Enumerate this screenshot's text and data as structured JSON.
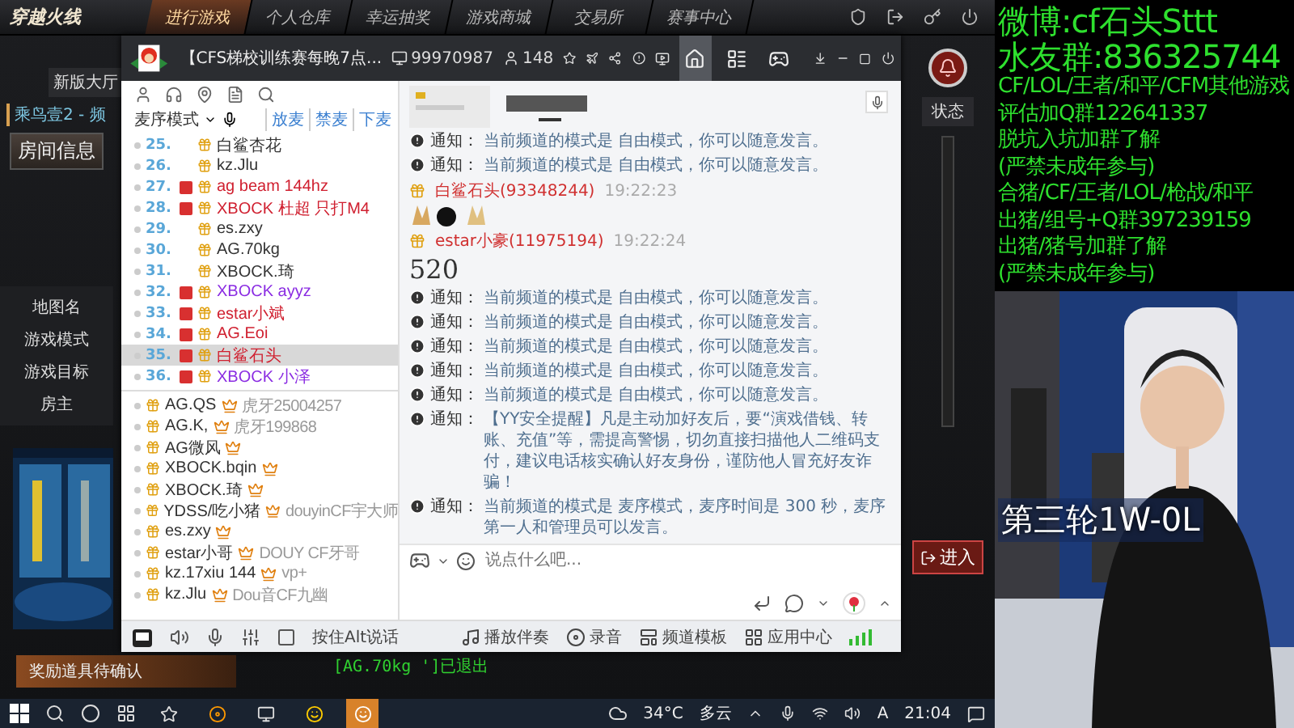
{
  "game": {
    "logo": "穿越火线",
    "nav_tabs": [
      {
        "label": "进行游戏",
        "selected": true
      },
      {
        "label": "个人仓库",
        "selected": false
      },
      {
        "label": "幸运抽奖",
        "selected": false
      },
      {
        "label": "游戏商城",
        "selected": false
      },
      {
        "label": "交易所",
        "selected": false
      },
      {
        "label": "赛事中心",
        "selected": false
      }
    ],
    "lobby_label": "新版大厅",
    "channel": "乘鸟壹2 - 频",
    "room_info_button": "房间信息",
    "room_fields": [
      "地图名",
      "游戏模式",
      "游戏目标",
      "房主"
    ],
    "status_header": "状态",
    "enter_button": "进入",
    "reward_bar": "奖励道具待确认",
    "chat_log": "[AG.70kg ']已退出"
  },
  "yy_window": {
    "title": "【CFS梯校训练赛每晚7点...",
    "channel_id": "99970987",
    "online_count": "148",
    "header_tabs": [
      {
        "kind": "home",
        "selected": true
      },
      {
        "kind": "list",
        "selected": false
      },
      {
        "kind": "gamepad",
        "selected": false
      }
    ],
    "mic_mode": "麦序模式",
    "mic_actions": [
      "放麦",
      "禁麦",
      "下麦"
    ],
    "mic_queue": [
      {
        "rank": "25.",
        "name": "白鲨杏花",
        "color": "#333333",
        "vip": false,
        "selected": false
      },
      {
        "rank": "26.",
        "name": "kz.Jlu",
        "color": "#333333",
        "vip": false,
        "selected": false
      },
      {
        "rank": "27.",
        "name": "ag beam 144hz",
        "color": "#d02030",
        "vip": true,
        "selected": false
      },
      {
        "rank": "28.",
        "name": "XBOCK 杜超 只打M4",
        "color": "#d02030",
        "vip": true,
        "selected": false
      },
      {
        "rank": "29.",
        "name": "es.zxy",
        "color": "#333333",
        "vip": false,
        "selected": false
      },
      {
        "rank": "30.",
        "name": "AG.70kg",
        "color": "#333333",
        "vip": false,
        "selected": false
      },
      {
        "rank": "31.",
        "name": "XBOCK.琦",
        "color": "#333333",
        "vip": false,
        "selected": false
      },
      {
        "rank": "32.",
        "name": "XBOCK ayyz",
        "color": "#8a2be2",
        "vip": true,
        "selected": false
      },
      {
        "rank": "33.",
        "name": "estar小斌",
        "color": "#d02030",
        "vip": true,
        "selected": false
      },
      {
        "rank": "34.",
        "name": "AG.Eoi",
        "color": "#d02030",
        "vip": true,
        "selected": false
      },
      {
        "rank": "35.",
        "name": "白鲨石头",
        "color": "#d02030",
        "vip": true,
        "selected": true
      },
      {
        "rank": "36.",
        "name": "XBOCK 小泽",
        "color": "#8a2be2",
        "vip": true,
        "selected": false
      }
    ],
    "members": [
      {
        "name": "AG.QS",
        "note": "虎牙25004257"
      },
      {
        "name": "AG.K,",
        "note": "虎牙199868"
      },
      {
        "name": "AG微风"
      },
      {
        "name": "XBOCK.bqin"
      },
      {
        "name": "XBOCK.琦"
      },
      {
        "name": "YDSS/吃小猪",
        "note": "douyinCF宇大师"
      },
      {
        "name": "es.zxy"
      },
      {
        "name": "estar小哥",
        "note": "DOUY CF牙哥"
      },
      {
        "name": "kz.17xiu 144",
        "note": "vp+"
      },
      {
        "name": "kz.Jlu",
        "note": "Dou音CF九幽"
      }
    ],
    "messages": [
      {
        "kind": "notice",
        "label": "通知：",
        "text": "当前频道的模式是 自由模式，你可以随意发言。"
      },
      {
        "kind": "notice",
        "label": "通知：",
        "text": "当前频道的模式是 自由模式，你可以随意发言。"
      },
      {
        "kind": "user",
        "sender": "白鲨石头(93348244)",
        "time": "19:22:23",
        "stickers": true
      },
      {
        "kind": "user",
        "sender": "estar小豪(11975194)",
        "time": "19:22:24",
        "text": "520"
      },
      {
        "kind": "notice",
        "label": "通知：",
        "text": "当前频道的模式是 自由模式，你可以随意发言。"
      },
      {
        "kind": "notice",
        "label": "通知：",
        "text": "当前频道的模式是 自由模式，你可以随意发言。"
      },
      {
        "kind": "notice",
        "label": "通知：",
        "text": "当前频道的模式是 自由模式，你可以随意发言。"
      },
      {
        "kind": "notice",
        "label": "通知：",
        "text": "当前频道的模式是 自由模式，你可以随意发言。"
      },
      {
        "kind": "notice",
        "label": "通知：",
        "text": "当前频道的模式是 自由模式，你可以随意发言。"
      },
      {
        "kind": "notice",
        "label": "通知：",
        "text": "【YY安全提醒】凡是主动加好友后，要“演戏借钱、转账、充值”等，需提高警惕，切勿直接扫描他人二维码支付，建议电话核实确认好友身份，谨防他人冒充好友诈骗！"
      },
      {
        "kind": "notice",
        "label": "通知：",
        "text": "当前频道的模式是 麦序模式，麦序时间是 300 秒，麦序第一人和管理员可以发言。"
      }
    ],
    "input": {
      "placeholder": "说点什么吧..."
    },
    "push_to_talk": "按住Alt说话",
    "bottom_actions": [
      {
        "kind": "music",
        "label": "播放伴奏"
      },
      {
        "kind": "record",
        "label": "录音"
      },
      {
        "kind": "template",
        "label": "频道模板"
      },
      {
        "kind": "apps",
        "label": "应用中心"
      }
    ]
  },
  "overlay": {
    "lines": [
      {
        "text": "微博:cf石头Sttt",
        "kind": "large"
      },
      {
        "text": "水友群:836325744",
        "kind": "large"
      },
      {
        "text": "CF/LOL/王者/和平/CFM其他游戏",
        "kind": "small"
      },
      {
        "text": "评估加Q群122641337",
        "kind": "small"
      },
      {
        "text": "脱坑入坑加群了解",
        "kind": "small"
      },
      {
        "text": "(严禁未成年参与)",
        "kind": "small"
      },
      {
        "text": "合猪/CF/王者/LOL/枪战/和平",
        "kind": "small"
      },
      {
        "text": "出猪/组号+Q群397239159",
        "kind": "small"
      },
      {
        "text": "出猪/猪号加群了解",
        "kind": "small"
      },
      {
        "text": "(严禁未成年参与)",
        "kind": "small"
      }
    ],
    "webcam_caption": "第三轮1W-0L"
  },
  "taskbar": {
    "temperature": "34°C",
    "weather": "多云",
    "ime": "A",
    "clock": "21:04"
  }
}
